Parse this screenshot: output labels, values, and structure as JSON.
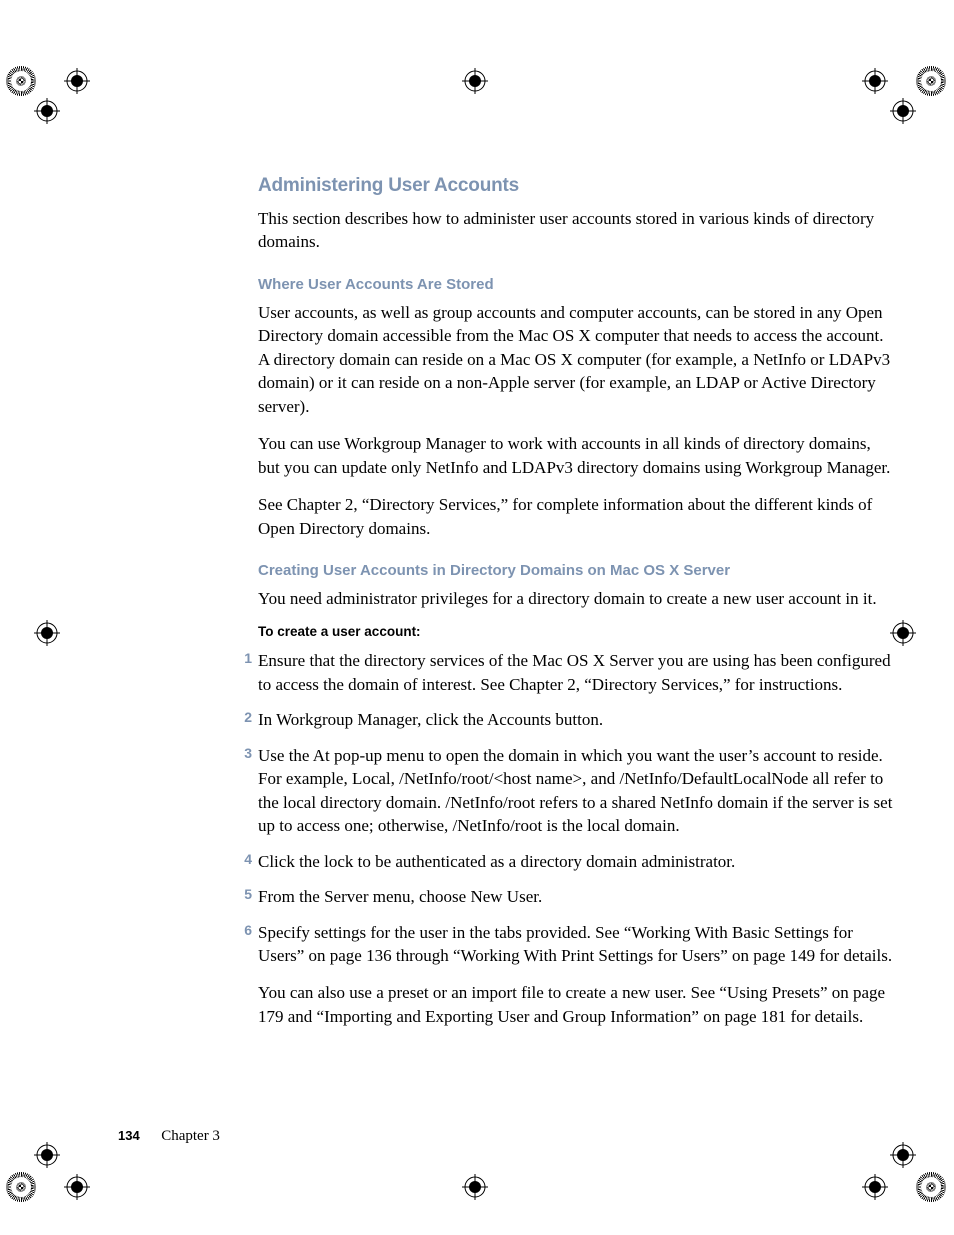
{
  "headings": {
    "h1": "Administering User Accounts",
    "h2a": "Where User Accounts Are Stored",
    "h2b": "Creating User Accounts in Directory Domains on Mac OS X Server",
    "h3": "To create a user account:"
  },
  "paragraphs": {
    "intro": "This section describes how to administer user accounts stored in various kinds of directory domains.",
    "stored1": "User accounts, as well as group accounts and computer accounts, can be stored in any Open Directory domain accessible from the Mac OS X computer that needs to access the account. A directory domain can reside on a Mac OS X computer (for example, a NetInfo or LDAPv3 domain) or it can reside on a non-Apple server (for example, an LDAP or Active Directory server).",
    "stored2": "You can use Workgroup Manager to work with accounts in all kinds of directory domains, but you can update only NetInfo and LDAPv3 directory domains using Workgroup Manager.",
    "stored3": "See Chapter 2, “Directory Services,” for complete information about the different kinds of Open Directory domains.",
    "creating_intro": "You need administrator privileges for a directory domain to create a new user account in it."
  },
  "steps": [
    "Ensure that the directory services of the Mac OS X Server you are using has been configured to access the domain of interest. See Chapter 2, “Directory Services,” for instructions.",
    "In Workgroup Manager, click the Accounts button.",
    "Use the At pop-up menu to open the domain in which you want the user’s account to reside. For example, Local, /NetInfo/root/<host name>, and /NetInfo/DefaultLocalNode all refer to the local directory domain. /NetInfo/root refers to a shared NetInfo domain if the server is set up to access one; otherwise, /NetInfo/root is the local domain.",
    "Click the lock to be authenticated as a directory domain administrator.",
    "From the Server menu, choose New User.",
    "Specify settings for the user in the tabs provided. See “Working With Basic Settings for Users” on page 136 through “Working With Print Settings for Users” on page 149 for details."
  ],
  "step6_extra": "You can also use a preset or an import file to create a new user. See “Using Presets” on page 179 and “Importing and Exporting User and Group Information” on page 181 for details.",
  "footer": {
    "page_number": "134",
    "chapter": "Chapter 3"
  }
}
